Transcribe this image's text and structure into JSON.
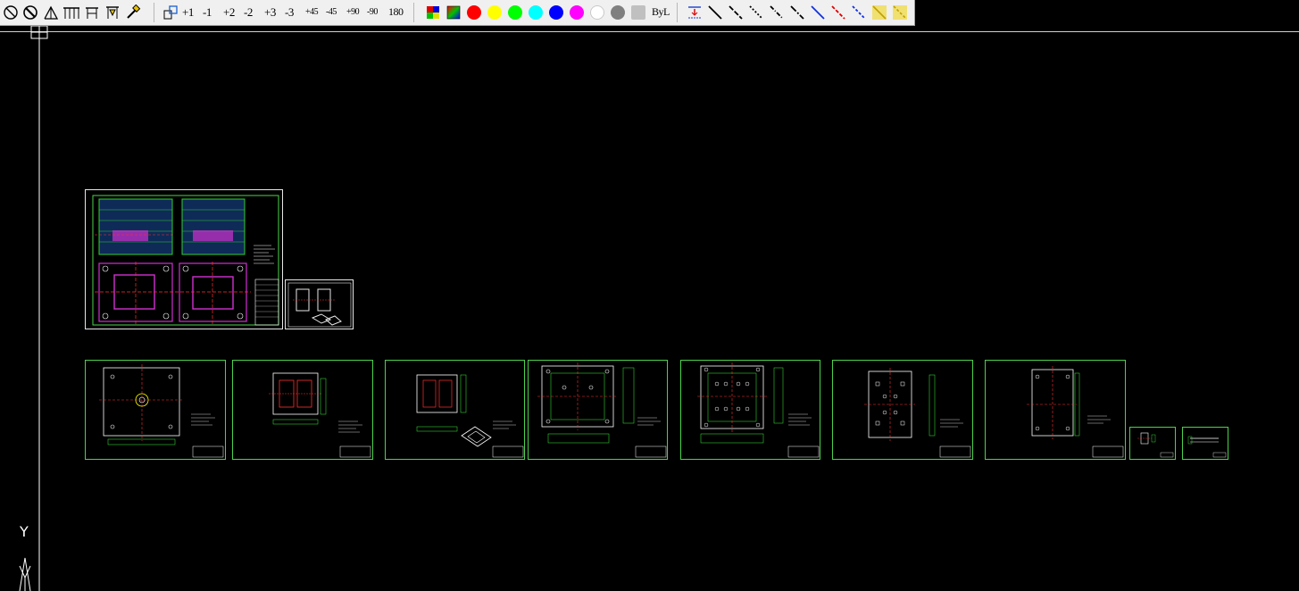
{
  "toolbar": {
    "rotate_labels": [
      "+1",
      "-1",
      "+2",
      "-2",
      "+3",
      "-3",
      "+45",
      "-45",
      "+90",
      "-90",
      "180"
    ],
    "bylayer_label": "ByL",
    "colors": [
      "#ff0000",
      "#ffff00",
      "#00ff00",
      "#00ffff",
      "#0000ff",
      "#ff00ff",
      "#ffffff",
      "#808080",
      "#c0c0c0"
    ]
  },
  "ucs": {
    "y_label": "Y"
  }
}
